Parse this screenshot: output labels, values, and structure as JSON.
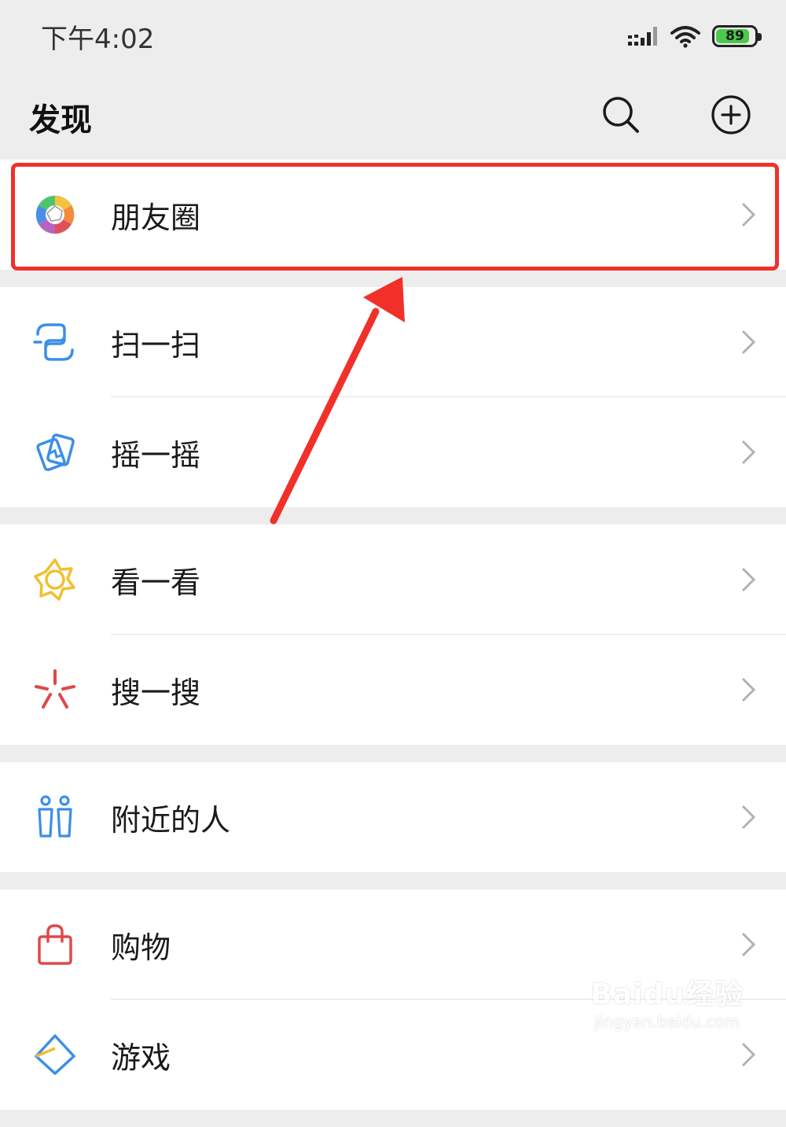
{
  "status_bar": {
    "time": "下午4:02",
    "battery_level": "89",
    "battery_fraction": 0.89
  },
  "header": {
    "title": "发现",
    "search_icon": "search-icon",
    "add_icon": "plus-circle-icon"
  },
  "groups": [
    [
      {
        "id": "moments",
        "label": "朋友圈",
        "icon": "aperture-icon"
      }
    ],
    [
      {
        "id": "scan",
        "label": "扫一扫",
        "icon": "scan-icon"
      },
      {
        "id": "shake",
        "label": "摇一摇",
        "icon": "shake-icon"
      }
    ],
    [
      {
        "id": "top-stories",
        "label": "看一看",
        "icon": "star-icon"
      },
      {
        "id": "search",
        "label": "搜一搜",
        "icon": "sparkle-icon"
      }
    ],
    [
      {
        "id": "nearby",
        "label": "附近的人",
        "icon": "people-icon"
      }
    ],
    [
      {
        "id": "shopping",
        "label": "购物",
        "icon": "bag-icon"
      },
      {
        "id": "games",
        "label": "游戏",
        "icon": "game-icon"
      }
    ]
  ],
  "colors": {
    "highlight": "#f2302a",
    "background": "#ededed",
    "battery": "#4cc94a"
  },
  "watermark": {
    "main": "Baidu经验",
    "sub": "jingyan.baidu.com"
  }
}
